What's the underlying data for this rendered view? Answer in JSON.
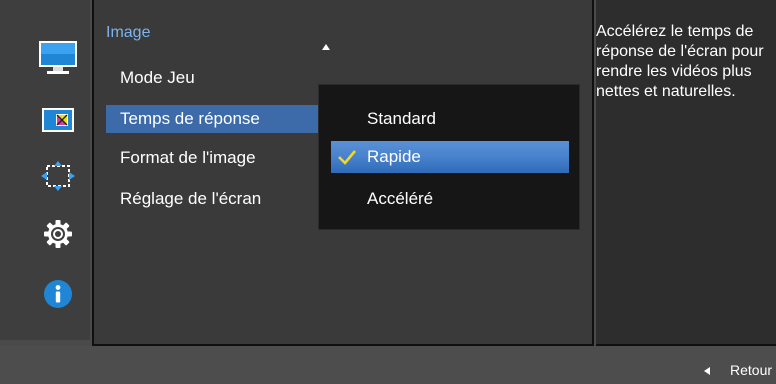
{
  "sidebar": {
    "icons": [
      "monitor-icon",
      "color-icon",
      "resize-icon",
      "settings-gear-icon",
      "info-icon"
    ],
    "active_index": 0
  },
  "main": {
    "title": "Image",
    "items": [
      {
        "label": "Mode Jeu"
      },
      {
        "label": "Temps de réponse",
        "selected": true
      },
      {
        "label": "Format de l'image"
      },
      {
        "label": "Réglage de l'écran"
      }
    ]
  },
  "dropdown": {
    "options": [
      {
        "label": "Standard"
      },
      {
        "label": "Rapide",
        "selected": true
      },
      {
        "label": "Accéléré"
      }
    ]
  },
  "help": {
    "text": "Accélérez le temps de réponse de l'écran pour rendre les vidéos plus nettes et naturelles."
  },
  "footer": {
    "back_label": "Retour"
  },
  "colors": {
    "accent": "#3d6aa8",
    "title": "#7db4ec",
    "check": "#f5d81e",
    "info": "#1f86d6"
  }
}
